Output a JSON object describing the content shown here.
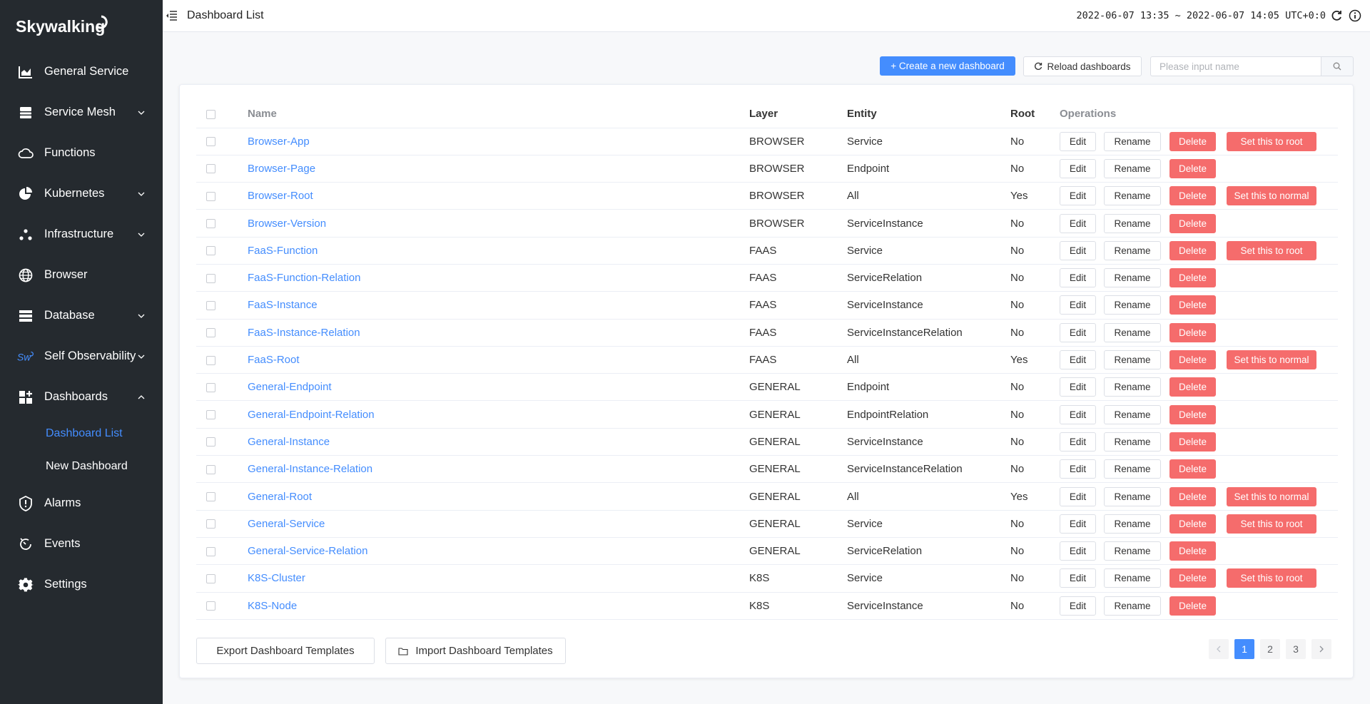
{
  "brand": {
    "name": "Skywalking"
  },
  "sidebar": {
    "items": [
      {
        "label": "General Service",
        "icon": "chart-icon",
        "expandable": false
      },
      {
        "label": "Service Mesh",
        "icon": "layers-icon",
        "expandable": true
      },
      {
        "label": "Functions",
        "icon": "cloud-icon",
        "expandable": false
      },
      {
        "label": "Kubernetes",
        "icon": "pie-icon",
        "expandable": true
      },
      {
        "label": "Infrastructure",
        "icon": "nodes-icon",
        "expandable": true
      },
      {
        "label": "Browser",
        "icon": "globe-icon",
        "expandable": false
      },
      {
        "label": "Database",
        "icon": "database-icon",
        "expandable": true
      },
      {
        "label": "Self Observability",
        "icon": "sw-logo-icon",
        "expandable": true
      },
      {
        "label": "Dashboards",
        "icon": "dashboard-icon",
        "expandable": true,
        "expanded": true
      }
    ],
    "sub_items": [
      {
        "label": "Dashboard List",
        "active": true
      },
      {
        "label": "New Dashboard",
        "active": false
      }
    ],
    "bottom_items": [
      {
        "label": "Alarms",
        "icon": "alarm-icon"
      },
      {
        "label": "Events",
        "icon": "events-icon"
      },
      {
        "label": "Settings",
        "icon": "gear-icon"
      }
    ]
  },
  "header": {
    "title": "Dashboard List",
    "time_range": "2022-06-07 13:35 ~ 2022-06-07 14:05",
    "timezone": "UTC+0:0"
  },
  "toolbar": {
    "create_label": "+ Create a new dashboard",
    "reload_label": "Reload dashboards",
    "search_placeholder": "Please input name"
  },
  "table": {
    "columns": [
      "Name",
      "Layer",
      "Entity",
      "Root",
      "Operations"
    ],
    "op_labels": {
      "edit": "Edit",
      "rename": "Rename",
      "delete": "Delete",
      "set_root": "Set this to root",
      "set_normal": "Set this to normal"
    },
    "rows": [
      {
        "name": "Browser-App",
        "layer": "BROWSER",
        "entity": "Service",
        "root": "No",
        "extra": "set_root"
      },
      {
        "name": "Browser-Page",
        "layer": "BROWSER",
        "entity": "Endpoint",
        "root": "No",
        "extra": ""
      },
      {
        "name": "Browser-Root",
        "layer": "BROWSER",
        "entity": "All",
        "root": "Yes",
        "extra": "set_normal"
      },
      {
        "name": "Browser-Version",
        "layer": "BROWSER",
        "entity": "ServiceInstance",
        "root": "No",
        "extra": ""
      },
      {
        "name": "FaaS-Function",
        "layer": "FAAS",
        "entity": "Service",
        "root": "No",
        "extra": "set_root"
      },
      {
        "name": "FaaS-Function-Relation",
        "layer": "FAAS",
        "entity": "ServiceRelation",
        "root": "No",
        "extra": ""
      },
      {
        "name": "FaaS-Instance",
        "layer": "FAAS",
        "entity": "ServiceInstance",
        "root": "No",
        "extra": ""
      },
      {
        "name": "FaaS-Instance-Relation",
        "layer": "FAAS",
        "entity": "ServiceInstanceRelation",
        "root": "No",
        "extra": ""
      },
      {
        "name": "FaaS-Root",
        "layer": "FAAS",
        "entity": "All",
        "root": "Yes",
        "extra": "set_normal"
      },
      {
        "name": "General-Endpoint",
        "layer": "GENERAL",
        "entity": "Endpoint",
        "root": "No",
        "extra": ""
      },
      {
        "name": "General-Endpoint-Relation",
        "layer": "GENERAL",
        "entity": "EndpointRelation",
        "root": "No",
        "extra": ""
      },
      {
        "name": "General-Instance",
        "layer": "GENERAL",
        "entity": "ServiceInstance",
        "root": "No",
        "extra": ""
      },
      {
        "name": "General-Instance-Relation",
        "layer": "GENERAL",
        "entity": "ServiceInstanceRelation",
        "root": "No",
        "extra": ""
      },
      {
        "name": "General-Root",
        "layer": "GENERAL",
        "entity": "All",
        "root": "Yes",
        "extra": "set_normal"
      },
      {
        "name": "General-Service",
        "layer": "GENERAL",
        "entity": "Service",
        "root": "No",
        "extra": "set_root"
      },
      {
        "name": "General-Service-Relation",
        "layer": "GENERAL",
        "entity": "ServiceRelation",
        "root": "No",
        "extra": ""
      },
      {
        "name": "K8S-Cluster",
        "layer": "K8S",
        "entity": "Service",
        "root": "No",
        "extra": "set_root"
      },
      {
        "name": "K8S-Node",
        "layer": "K8S",
        "entity": "ServiceInstance",
        "root": "No",
        "extra": ""
      }
    ]
  },
  "footer": {
    "export_label": "Export Dashboard Templates",
    "import_label": "Import Dashboard Templates",
    "pages": [
      "1",
      "2",
      "3"
    ],
    "current_page": "1"
  },
  "colors": {
    "sidebar_bg": "#252a2f",
    "primary": "#448dfe",
    "danger": "#f56c6c"
  }
}
